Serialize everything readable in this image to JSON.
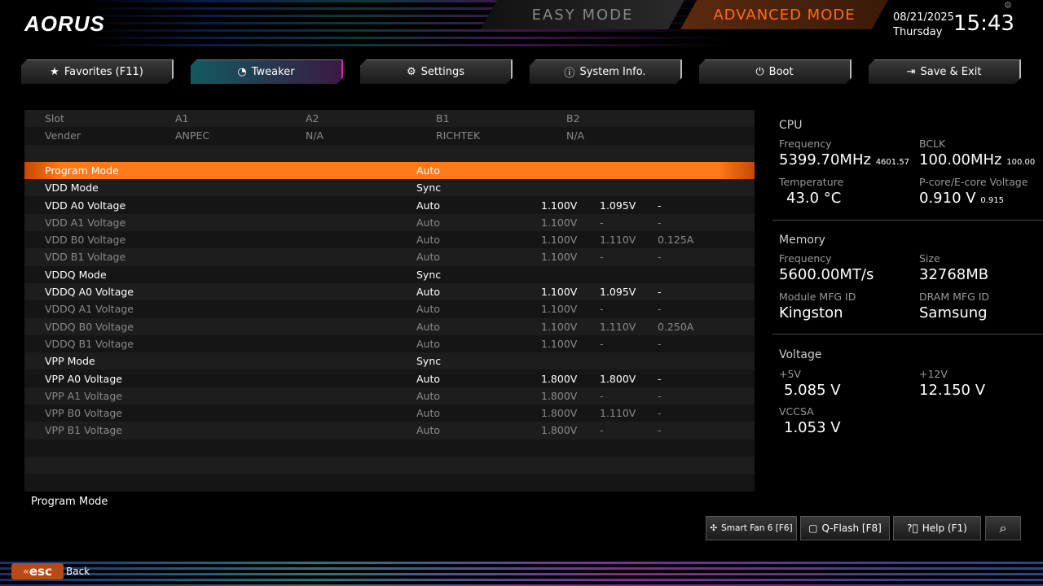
{
  "header": {
    "logo": "AORUS",
    "easy_mode": "EASY MODE",
    "advanced_mode": "ADVANCED MODE",
    "date": "08/21/2025",
    "day": "Thursday",
    "time": "15:43"
  },
  "tabs": [
    {
      "label": "Favorites (F11)",
      "icon": "★"
    },
    {
      "label": "Tweaker",
      "icon": "◔"
    },
    {
      "label": "Settings",
      "icon": "⚙"
    },
    {
      "label": "System Info.",
      "icon": "ⓘ"
    },
    {
      "label": "Boot",
      "icon": "⏻"
    },
    {
      "label": "Save & Exit",
      "icon": "⇥"
    }
  ],
  "slot_header": {
    "cols": [
      "Slot",
      "A1",
      "A2",
      "B1",
      "B2"
    ],
    "vendor": [
      "Vender",
      "ANPEC",
      "N/A",
      "RICHTEK",
      "N/A"
    ]
  },
  "rows": [
    {
      "name": "Program Mode",
      "value": "Auto",
      "c1": "",
      "c2": "",
      "c3": "",
      "state": "selected"
    },
    {
      "name": "VDD Mode",
      "value": "Sync",
      "c1": "",
      "c2": "",
      "c3": "",
      "state": "on"
    },
    {
      "name": "VDD A0 Voltage",
      "value": "Auto",
      "c1": "1.100V",
      "c2": "1.095V",
      "c3": "-",
      "state": "on"
    },
    {
      "name": "VDD A1 Voltage",
      "value": "Auto",
      "c1": "1.100V",
      "c2": "-",
      "c3": "-",
      "state": "dim"
    },
    {
      "name": "VDD B0 Voltage",
      "value": "Auto",
      "c1": "1.100V",
      "c2": "1.110V",
      "c3": "0.125A",
      "state": "dim"
    },
    {
      "name": "VDD B1 Voltage",
      "value": "Auto",
      "c1": "1.100V",
      "c2": "-",
      "c3": "-",
      "state": "dim"
    },
    {
      "name": "VDDQ Mode",
      "value": "Sync",
      "c1": "",
      "c2": "",
      "c3": "",
      "state": "on"
    },
    {
      "name": "VDDQ A0 Voltage",
      "value": "Auto",
      "c1": "1.100V",
      "c2": "1.095V",
      "c3": "-",
      "state": "on"
    },
    {
      "name": "VDDQ A1 Voltage",
      "value": "Auto",
      "c1": "1.100V",
      "c2": "-",
      "c3": "-",
      "state": "dim"
    },
    {
      "name": "VDDQ B0 Voltage",
      "value": "Auto",
      "c1": "1.100V",
      "c2": "1.110V",
      "c3": "0.250A",
      "state": "dim"
    },
    {
      "name": "VDDQ B1 Voltage",
      "value": "Auto",
      "c1": "1.100V",
      "c2": "-",
      "c3": "-",
      "state": "dim"
    },
    {
      "name": "VPP Mode",
      "value": "Sync",
      "c1": "",
      "c2": "",
      "c3": "",
      "state": "on"
    },
    {
      "name": "VPP A0 Voltage",
      "value": "Auto",
      "c1": "1.800V",
      "c2": "1.800V",
      "c3": "-",
      "state": "on"
    },
    {
      "name": "VPP A1 Voltage",
      "value": "Auto",
      "c1": "1.800V",
      "c2": "-",
      "c3": "-",
      "state": "dim"
    },
    {
      "name": "VPP B0 Voltage",
      "value": "Auto",
      "c1": "1.800V",
      "c2": "1.110V",
      "c3": "-",
      "state": "dim"
    },
    {
      "name": "VPP B1 Voltage",
      "value": "Auto",
      "c1": "1.800V",
      "c2": "-",
      "c3": "-",
      "state": "dim"
    }
  ],
  "help_text": "Program Mode",
  "cpu": {
    "title": "CPU",
    "freq_label": "Frequency",
    "freq": "5399.70MHz",
    "freq_sub": "4601.57",
    "bclk_label": "BCLK",
    "bclk": "100.00MHz",
    "bclk_sub": "100.00",
    "temp_label": "Temperature",
    "temp": "43.0 °C",
    "volt_label": "P-core/E-core Voltage",
    "volt": "0.910 V",
    "volt_sub": "0.915"
  },
  "memory": {
    "title": "Memory",
    "freq_label": "Frequency",
    "freq": "5600.00MT/s",
    "size_label": "Size",
    "size": "32768MB",
    "mfg_label": "Module MFG ID",
    "mfg": "Kingston",
    "dram_label": "DRAM MFG ID",
    "dram": "Samsung"
  },
  "voltage": {
    "title": "Voltage",
    "v5_label": "+5V",
    "v5": "5.085 V",
    "v12_label": "+12V",
    "v12": "12.150 V",
    "vccsa_label": "VCCSA",
    "vccsa": "1.053 V"
  },
  "footer": {
    "smartfan": "Smart Fan 6 [F6]",
    "qflash": "Q-Flash [F8]",
    "help": "Help (F1)",
    "esc": "esc",
    "back": "Back"
  }
}
